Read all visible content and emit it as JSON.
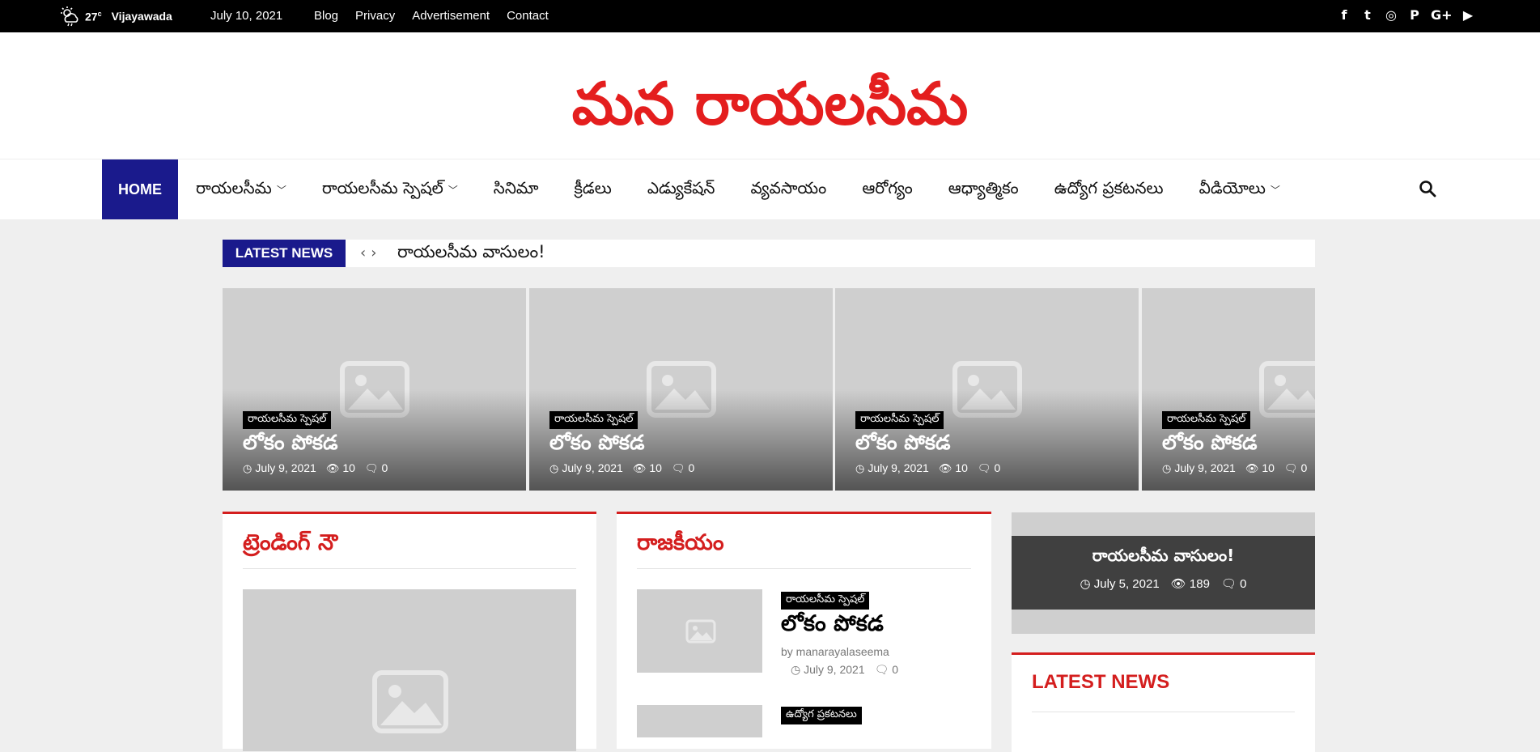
{
  "topbar": {
    "temperature": "27",
    "temp_unit": "c",
    "city": "Vijayawada",
    "date": "July 10, 2021",
    "links": [
      "Blog",
      "Privacy",
      "Advertisement",
      "Contact"
    ],
    "social": [
      {
        "name": "facebook-icon",
        "glyph": "f"
      },
      {
        "name": "twitter-icon",
        "glyph": "t"
      },
      {
        "name": "instagram-icon",
        "glyph": "◎"
      },
      {
        "name": "pinterest-icon",
        "glyph": "P"
      },
      {
        "name": "google-plus-icon",
        "glyph": "G+"
      },
      {
        "name": "youtube-icon",
        "glyph": "▶"
      }
    ]
  },
  "header": {
    "logo": "మన రాయలసీమ"
  },
  "nav": {
    "home": "HOME",
    "items": [
      {
        "label": "రాయలసీమ",
        "dropdown": true
      },
      {
        "label": "రాయలసీమ స్పెషల్",
        "dropdown": true
      },
      {
        "label": "సినిమా",
        "dropdown": false
      },
      {
        "label": "క్రీడలు",
        "dropdown": false
      },
      {
        "label": "ఎడ్యుకేషన్",
        "dropdown": false
      },
      {
        "label": "వ్యవసాయం",
        "dropdown": false
      },
      {
        "label": "ఆరోగ్యం",
        "dropdown": false
      },
      {
        "label": "ఆధ్యాత్మికం",
        "dropdown": false
      },
      {
        "label": "ఉద్యోగ ప్రకటనలు",
        "dropdown": false
      },
      {
        "label": "వీడియోలు",
        "dropdown": true
      }
    ]
  },
  "ticker": {
    "label": "LATEST NEWS",
    "text": "రాయలసీమ వాసులం!"
  },
  "cards": [
    {
      "category": "రాయలసీమ స్పెషల్",
      "title": "లోకం పోకడ",
      "date": "July 9, 2021",
      "views": "10",
      "comments": "0"
    },
    {
      "category": "రాయలసీమ స్పెషల్",
      "title": "లోకం పోకడ",
      "date": "July 9, 2021",
      "views": "10",
      "comments": "0"
    },
    {
      "category": "రాయలసీమ స్పెషల్",
      "title": "లోకం పోకడ",
      "date": "July 9, 2021",
      "views": "10",
      "comments": "0"
    },
    {
      "category": "రాయలసీమ స్పెషల్",
      "title": "లోకం పోకడ",
      "date": "July 9, 2021",
      "views": "10",
      "comments": "0"
    }
  ],
  "trending": {
    "heading": "ట్రెండింగ్ నౌ"
  },
  "politics": {
    "heading": "రాజకీయం",
    "post": {
      "category": "రాయలసీమ స్పెషల్",
      "title": "లోకం పోకడ",
      "by": "by manarayalaseema",
      "date": "July 9, 2021",
      "comments": "0"
    },
    "next_category": "ఉద్యోగ ప్రకటనలు"
  },
  "featured": {
    "title": "రాయలసీమ వాసులం!",
    "date": "July 5, 2021",
    "views": "189",
    "comments": "0"
  },
  "latest_news_widget": {
    "heading": "LATEST NEWS"
  }
}
